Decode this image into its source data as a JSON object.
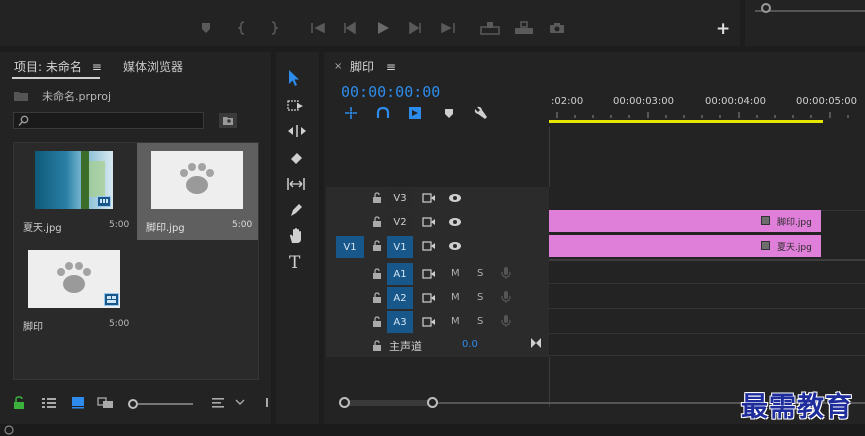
{
  "program_monitor": {
    "controls": [
      "marker-icon",
      "mark-in-icon",
      "mark-out-icon",
      "go-to-in-icon",
      "step-back-icon",
      "play-icon",
      "step-forward-icon",
      "go-to-out-icon",
      "lift-icon",
      "extract-icon",
      "export-frame-icon",
      "add-button-icon"
    ],
    "add_label": "+"
  },
  "project": {
    "tab_label": "项目: 未命名",
    "tab_menu": "≡",
    "media_browser_label": "媒体浏览器",
    "project_file": "未命名.prproj",
    "search_placeholder": "",
    "items": [
      {
        "name": "夏天.jpg",
        "duration": "5:00",
        "kind": "photo-blue"
      },
      {
        "name": "脚印.jpg",
        "duration": "5:00",
        "kind": "paw",
        "selected": true
      },
      {
        "name": "脚印",
        "duration": "5:00",
        "kind": "paw-seq"
      }
    ]
  },
  "tools": [
    "selection-tool-icon",
    "track-select-tool-icon",
    "ripple-edit-tool-icon",
    "razor-tool-icon",
    "slip-tool-icon",
    "pen-tool-icon",
    "hand-tool-icon",
    "type-tool-icon"
  ],
  "timeline": {
    "close_label": "×",
    "tab_label": "脚印",
    "tab_menu": "≡",
    "timecode": "00:00:00:00",
    "ruler_labels": [
      ":02:00",
      "00:00:03:00",
      "00:00:04:00",
      "00:00:05:00"
    ],
    "video_tracks": [
      {
        "label": "V3",
        "source": ""
      },
      {
        "label": "V2",
        "source": ""
      },
      {
        "label": "V1",
        "source": "V1"
      }
    ],
    "audio_tracks": [
      {
        "label": "A1",
        "m": "M",
        "s": "S"
      },
      {
        "label": "A2",
        "m": "M",
        "s": "S"
      },
      {
        "label": "A3",
        "m": "M",
        "s": "S"
      }
    ],
    "master_label": "主声道",
    "master_value": "0.0",
    "clips": [
      {
        "name": "脚印.jpg",
        "track": "V2"
      },
      {
        "name": "夏天.jpg",
        "track": "V1"
      }
    ]
  },
  "watermark": "最需教育",
  "colors": {
    "accent": "#2d8ceb",
    "clip": "#e07fd9",
    "playhead_bar": "#e6e600",
    "track_blue": "#17578a"
  }
}
